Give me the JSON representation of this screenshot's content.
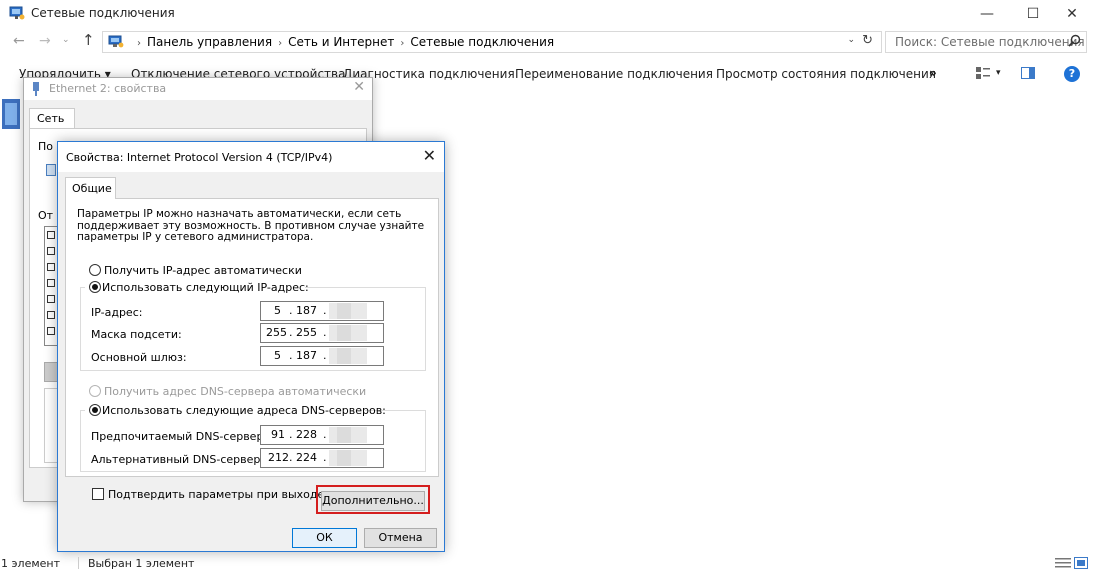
{
  "window": {
    "title": "Сетевые подключения",
    "icon": "network-connections-icon",
    "controls": {
      "minimize": "—",
      "maximize": "☐",
      "close": "✕"
    }
  },
  "nav": {
    "back": "←",
    "forward": "→",
    "recent": "⌄",
    "up": "↑",
    "breadcrumbs": [
      "Панель управления",
      "Сеть и Интернет",
      "Сетевые подключения"
    ],
    "crumb_separator": "›",
    "dropdown": "⌄",
    "refresh": "↻",
    "search_placeholder": "Поиск: Сетевые подключения"
  },
  "toolbar": {
    "organize": "Упорядочить ▾",
    "disconnect": "Отключение сетевого устройства",
    "diagnose": "Диагностика подключения",
    "rename": "Переименование подключения",
    "view_status": "Просмотр состояния подключения",
    "more": "»",
    "view_dropdown": "▾",
    "help": "?"
  },
  "statusbar": {
    "count": "1 элемент",
    "selected": "Выбран 1 элемент"
  },
  "eth_dialog": {
    "title": "Ethernet 2: свойства",
    "close": "✕",
    "tab": "Сеть",
    "label1": "По",
    "label2": "От"
  },
  "ipv4_dialog": {
    "title": "Свойства: Internet Protocol Version 4 (TCP/IPv4)",
    "close": "✕",
    "tab": "Общие",
    "description": [
      "Параметры IP можно назначать автоматически, если сеть",
      "поддерживает эту возможность. В противном случае узнайте",
      "параметры IP у сетевого администратора."
    ],
    "ip_auto": "Получить IP-адрес автоматически",
    "ip_manual": "Использовать следующий IP-адрес:",
    "ip_manual_selected": true,
    "ip_address_label": "IP-адрес:",
    "ip_address": [
      "5",
      "187"
    ],
    "subnet_label": "Маска подсети:",
    "subnet": [
      "255",
      "255"
    ],
    "gateway_label": "Основной шлюз:",
    "gateway": [
      "5",
      "187"
    ],
    "dns_auto": "Получить адрес DNS-сервера автоматически",
    "dns_manual": "Использовать следующие адреса DNS-серверов:",
    "dns_manual_selected": true,
    "dns_pref_label": "Предпочитаемый DNS-сервер:",
    "dns_pref": [
      "91",
      "228"
    ],
    "dns_alt_label": "Альтернативный DNS-сервер:",
    "dns_alt": [
      "212",
      "224"
    ],
    "validate_label": "Подтвердить параметры при выходе",
    "advanced_button": "Дополнительно...",
    "ok_button": "ОК",
    "cancel_button": "Отмена",
    "highlight_color": "#d41e1e"
  }
}
